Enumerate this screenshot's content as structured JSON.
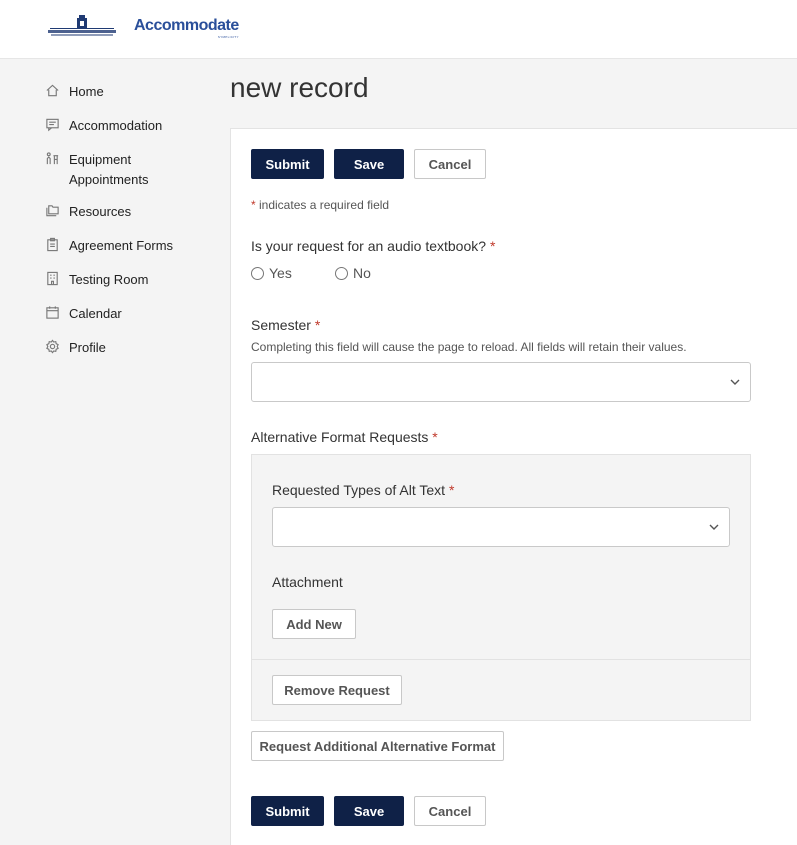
{
  "header": {
    "university_logo_alt": "Eastern Connecticut State University",
    "app_logo_text": "Accommodate",
    "app_logo_sub": "SYMPLICITY"
  },
  "sidebar": {
    "items": [
      {
        "label": "Home",
        "icon": "home-icon"
      },
      {
        "label": "Accommodation",
        "icon": "chat-list-icon"
      },
      {
        "label": "Equipment Appointments",
        "label_line1": "Equipment",
        "label_line2": "Appointments",
        "icon": "equipment-icon"
      },
      {
        "label": "Resources",
        "icon": "folders-icon"
      },
      {
        "label": "Agreement Forms",
        "icon": "clipboard-icon"
      },
      {
        "label": "Testing Room",
        "icon": "building-icon"
      },
      {
        "label": "Calendar",
        "icon": "calendar-icon"
      },
      {
        "label": "Profile",
        "icon": "gear-icon"
      }
    ]
  },
  "page": {
    "title": "new record"
  },
  "toolbar": {
    "submit_label": "Submit",
    "save_label": "Save",
    "cancel_label": "Cancel"
  },
  "form": {
    "required_note_star": "*",
    "required_note": " indicates a required field",
    "audio_question": "Is your request for an audio textbook?",
    "required_star": "*",
    "yes_label": "Yes",
    "no_label": "No",
    "semester_label": "Semester",
    "semester_help": "Completing this field will cause the page to reload. All fields will retain their values.",
    "semester_value": "",
    "alt_format_label": "Alternative Format Requests",
    "alt_types_label": "Requested Types of Alt Text",
    "alt_types_value": "",
    "attachment_label": "Attachment",
    "add_new_label": "Add New",
    "remove_request_label": "Remove Request",
    "request_additional_label": "Request Additional Alternative Format"
  },
  "colors": {
    "primary_button": "#0f2147",
    "required_star": "#c0392b",
    "logo_blue": "#2a4f9a"
  }
}
